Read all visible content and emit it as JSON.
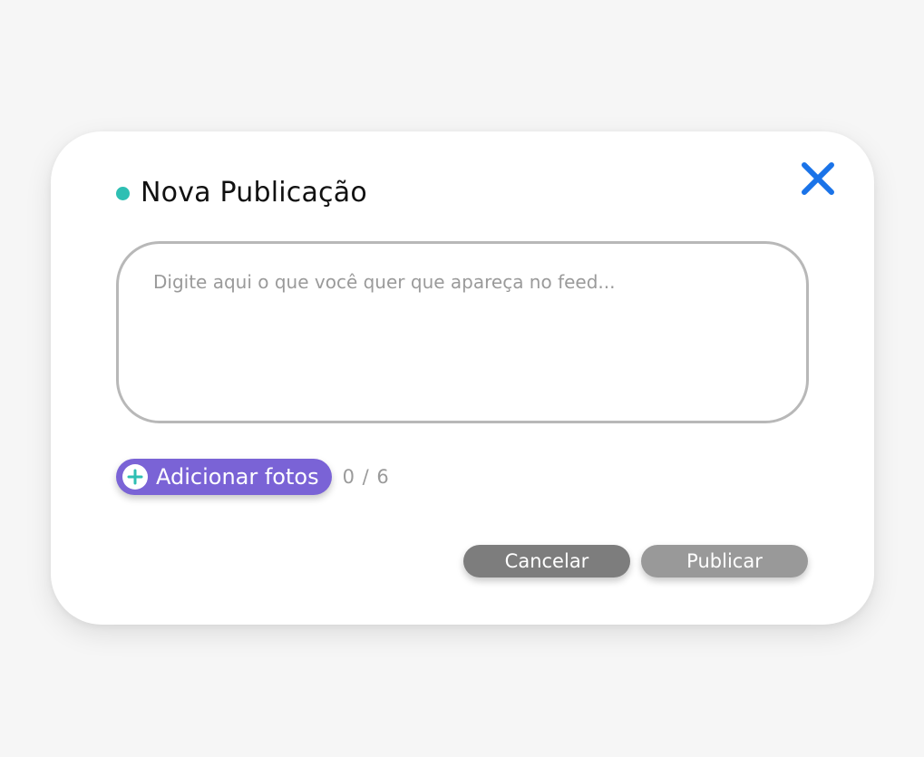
{
  "modal": {
    "title": "Nova Publicação",
    "title_dot_color": "#2ebfb3",
    "close_icon": "close-icon",
    "close_icon_color": "#1a73e8"
  },
  "composer": {
    "placeholder": "Digite aqui o que você quer que apareça no feed...",
    "value": ""
  },
  "photos": {
    "add_label": "Adicionar fotos",
    "add_icon": "plus-icon",
    "button_color": "#7a63d6",
    "count": "0 / 6"
  },
  "actions": {
    "cancel_label": "Cancelar",
    "publish_label": "Publicar"
  }
}
